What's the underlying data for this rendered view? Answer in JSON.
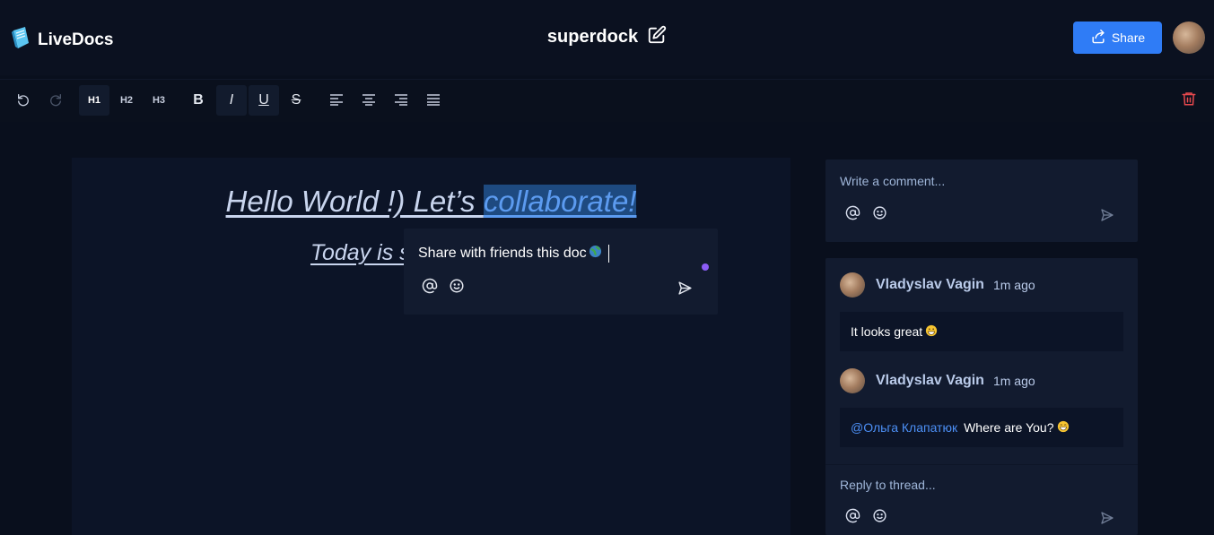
{
  "header": {
    "logo_text": "LiveDocs",
    "doc_title": "superdock",
    "share_label": "Share"
  },
  "toolbar": {
    "h1": "H1",
    "h2": "H2",
    "h3": "H3",
    "bold": "B",
    "italic": "I",
    "underline": "U",
    "strike": "S"
  },
  "editor": {
    "line1_part1": "Hello World !) Let’s ",
    "line1_highlight": "collaborate!",
    "line2": "Today is s"
  },
  "inline_comment": {
    "text": "Share with friends this doc"
  },
  "comment_box": {
    "placeholder": "Write a comment..."
  },
  "thread": {
    "comments": [
      {
        "author": "Vladyslav Vagin",
        "time": "1m ago",
        "text": "It looks great",
        "mention": ""
      },
      {
        "author": "Vladyslav Vagin",
        "time": "1m ago",
        "text": "Where are You?",
        "mention": "@Ольга Клапатюк"
      }
    ],
    "reply_placeholder": "Reply to thread..."
  },
  "colors": {
    "accent": "#2f7cf6",
    "background": "#090f1d",
    "panel": "#121b2f",
    "mention": "#4c8ff5",
    "trash": "#e5484d",
    "highlight": "#1e4a80"
  }
}
